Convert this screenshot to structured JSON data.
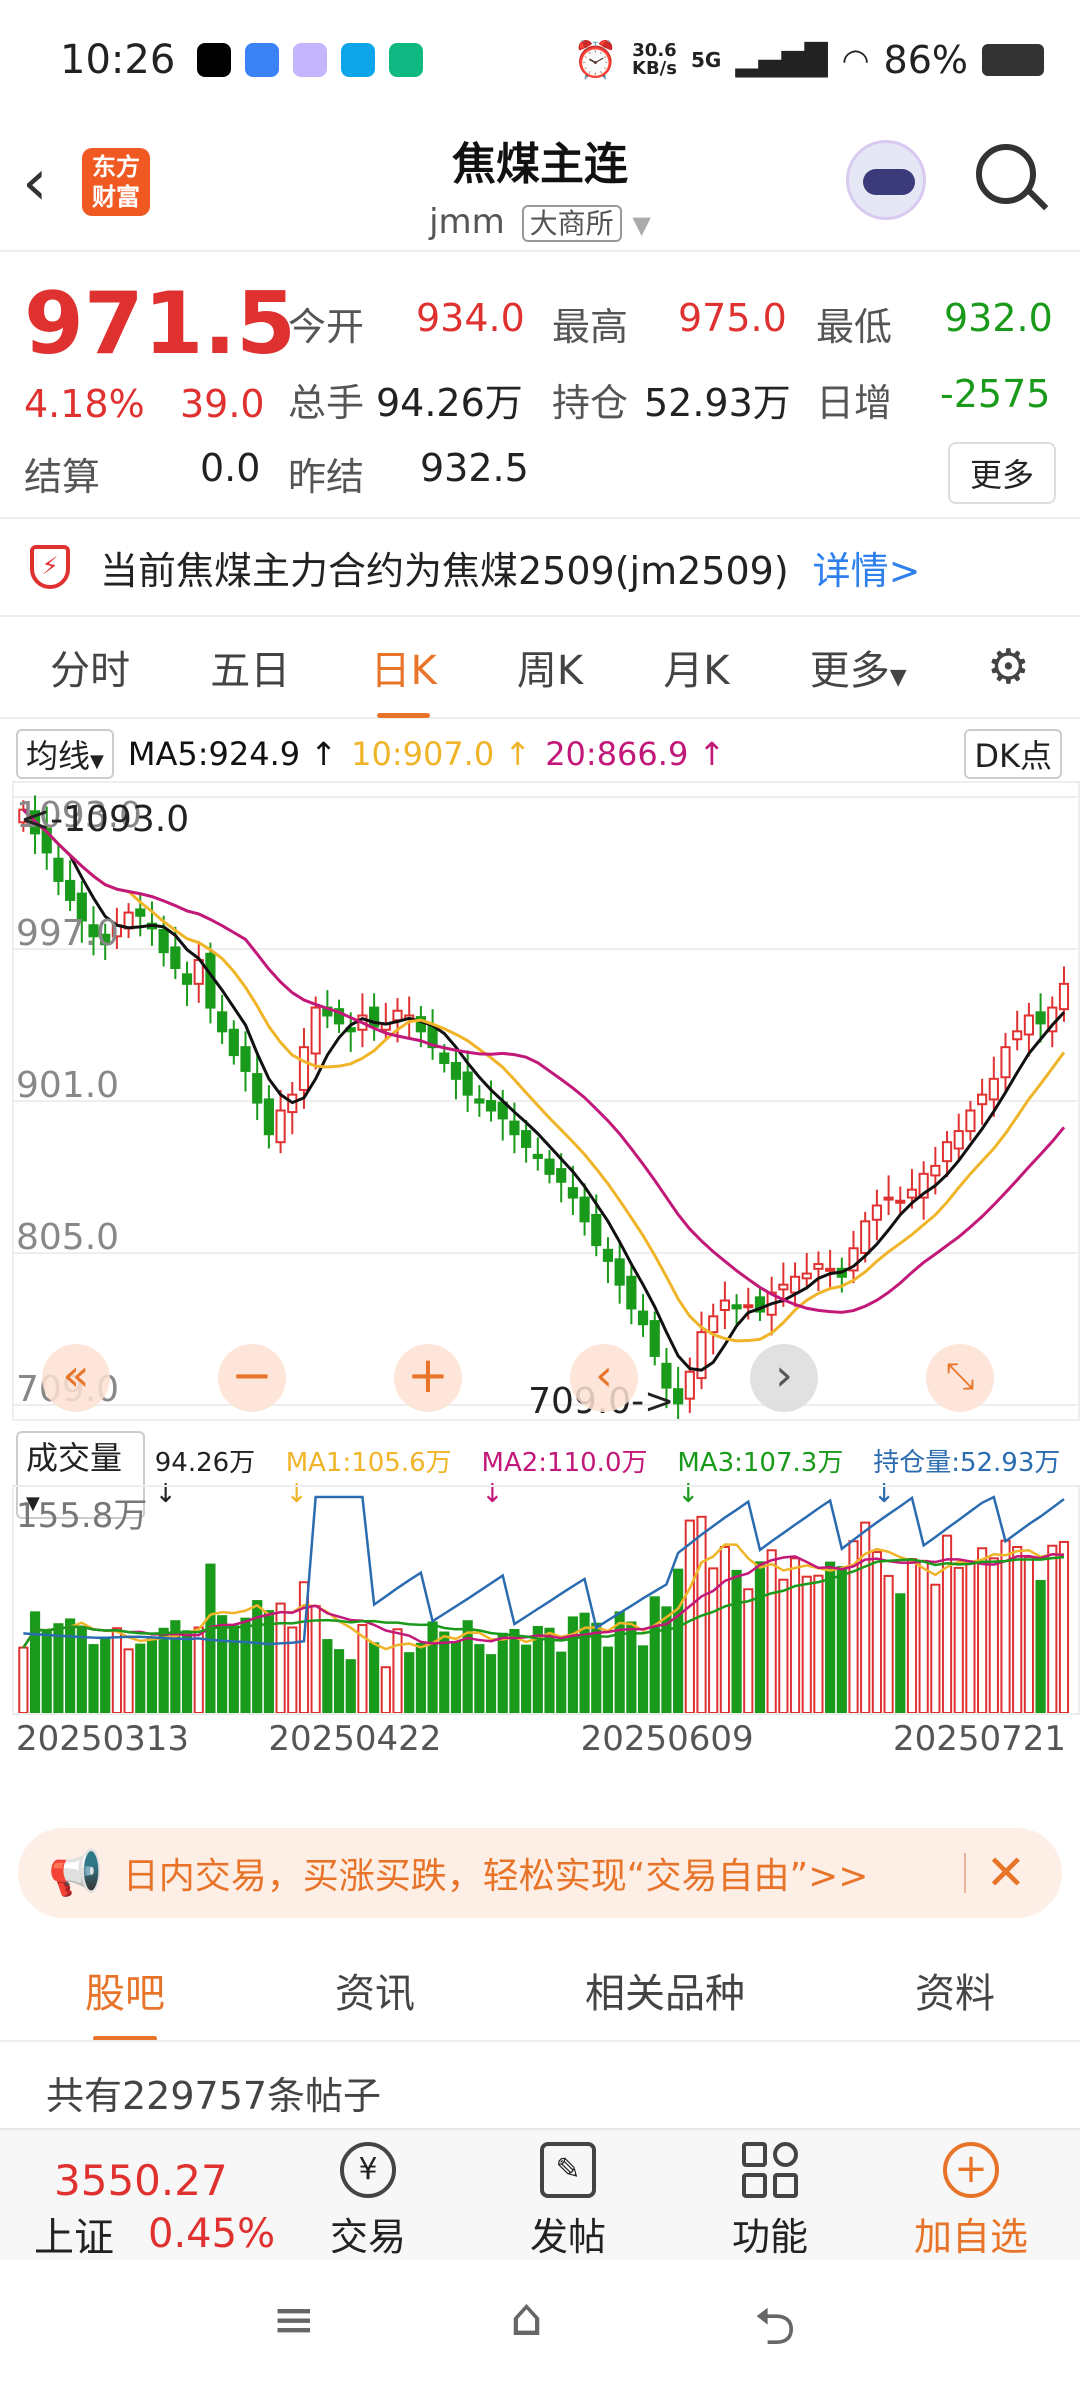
{
  "status_bar": {
    "time": "10:26",
    "net_speed_top": "30.6",
    "net_speed_unit": "KB/s",
    "net_type": "5G",
    "battery": "86%"
  },
  "header": {
    "title": "焦煤主连",
    "code": "jmm",
    "exchange": "大商所",
    "logo_line1": "东方",
    "logo_line2": "财富"
  },
  "quote": {
    "last": "971.5",
    "change_pct": "4.18%",
    "change": "39.0",
    "open_label": "今开",
    "open": "934.0",
    "high_label": "最高",
    "high": "975.0",
    "low_label": "最低",
    "low": "932.0",
    "volume_label": "总手",
    "volume": "94.26万",
    "oi_label": "持仓",
    "oi": "52.93万",
    "oi_change_label": "日增",
    "oi_change": "-2575",
    "settle_label": "结算",
    "settle": "0.0",
    "prev_settle_label": "昨结",
    "prev_settle": "932.5",
    "more_label": "更多"
  },
  "notice": {
    "text": "当前焦煤主力合约为焦煤2509(jm2509)",
    "link": "详情>"
  },
  "period_tabs": [
    "分时",
    "五日",
    "日K",
    "周K",
    "月K",
    "更多"
  ],
  "active_period": 2,
  "kline_legend": {
    "type": "均线",
    "ma5": "MA5:924.9 ↑",
    "ma10": "10:907.0 ↑",
    "ma20": "20:866.9 ↑",
    "dk": "DK点"
  },
  "price_axis": {
    "labels": [
      "1093.0",
      "997.0",
      "901.0",
      "805.0",
      "709.0"
    ],
    "high_marker": "<-1093.0",
    "low_marker": "709.0->"
  },
  "volume_legend": {
    "type": "成交量",
    "vol": "94.26万↓",
    "ma1": "MA1:105.6万↓",
    "ma2": "MA2:110.0万↓",
    "ma3": "MA3:107.3万↓",
    "oi": "持仓量:52.93万↓"
  },
  "volume_axis": {
    "top": "155.8万"
  },
  "date_axis": [
    "20250313",
    "20250422",
    "20250609",
    "20250721"
  ],
  "colors": {
    "up": "#e03131",
    "down": "#1a9a1a",
    "ma5": "#111111",
    "ma10": "#f0b429",
    "ma20": "#c2187a",
    "accent": "#e8742a",
    "oi_line": "#2b6cb0"
  },
  "chart_data": {
    "type": "candlestick",
    "y_range": [
      709.0,
      1093.0
    ],
    "closes": [
      1085,
      1070,
      1058,
      1040,
      1028,
      1015,
      1005,
      1000,
      1012,
      1020,
      1018,
      1010,
      995,
      985,
      975,
      990,
      960,
      945,
      930,
      920,
      900,
      880,
      895,
      905,
      935,
      960,
      955,
      950,
      945,
      955,
      948,
      950,
      958,
      955,
      945,
      935,
      925,
      915,
      905,
      900,
      895,
      890,
      880,
      872,
      865,
      855,
      850,
      840,
      825,
      810,
      800,
      785,
      770,
      760,
      740,
      720,
      710,
      730,
      755,
      765,
      775,
      770,
      772,
      768,
      780,
      785,
      790,
      792,
      798,
      795,
      790,
      808,
      825,
      835,
      840,
      838,
      845,
      855,
      860,
      875,
      882,
      895,
      905,
      915,
      935,
      945,
      955,
      950,
      960,
      975
    ],
    "ma5_last": "924.9",
    "ma10_last": "907.0",
    "ma20_last": "866.9"
  },
  "ad_banner": {
    "text": "日内交易，买涨买跌，轻松实现“交易自由”>>"
  },
  "bottom_tabs": [
    "股吧",
    "资讯",
    "相关品种",
    "资料"
  ],
  "posts_count": "共有229757条帖子",
  "index_ticker": {
    "value": "3550.27",
    "name": "上证",
    "pct": "0.45%"
  },
  "bottom_actions": [
    "交易",
    "发帖",
    "功能",
    "加自选"
  ]
}
